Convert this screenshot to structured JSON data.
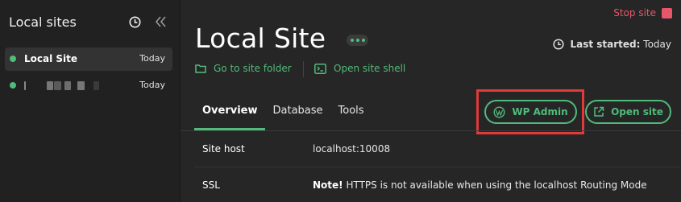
{
  "sidebar": {
    "title": "Local sites",
    "sites": [
      {
        "name": "Local Site",
        "date": "Today",
        "status_color": "#51bb7b"
      },
      {
        "name": "",
        "date": "Today",
        "status_color": "#51bb7b"
      }
    ]
  },
  "header": {
    "stop_label": "Stop site",
    "title": "Local Site",
    "last_started_label": "Last started:",
    "last_started_value": "Today"
  },
  "links": {
    "folder": "Go to site folder",
    "shell": "Open site shell"
  },
  "tabs": [
    "Overview",
    "Database",
    "Tools"
  ],
  "buttons": {
    "wp_admin": "WP Admin",
    "open_site": "Open site"
  },
  "details": {
    "site_host_label": "Site host",
    "site_host_value": "localhost:10008",
    "ssl_label": "SSL",
    "ssl_note": "Note!",
    "ssl_text": " HTTPS is not available when using the localhost Routing Mode"
  },
  "colors": {
    "accent": "#51bb7b",
    "danger": "#e8566b",
    "highlight": "#e2393b"
  }
}
